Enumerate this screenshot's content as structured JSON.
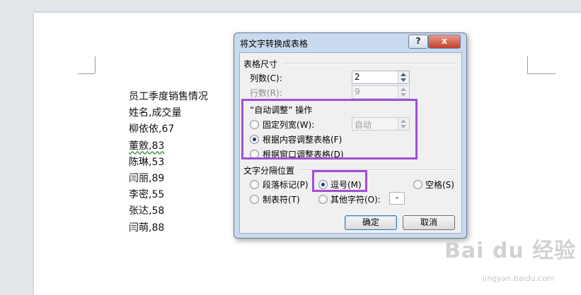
{
  "document": {
    "lines": [
      "员工季度销售情况",
      "姓名,成交量",
      "柳依依,67",
      "董敫,83",
      "陈琳,53",
      "闫丽,89",
      "李密,55",
      "张达,58",
      "闫萌,88"
    ]
  },
  "dialog": {
    "title": "将文字转换成表格",
    "help_label": "?",
    "close_label": "x",
    "table_size": {
      "section_label": "表格尺寸",
      "cols_label": "列数(C):",
      "cols_value": "2",
      "rows_label": "行数(R):",
      "rows_value": "9"
    },
    "autofit": {
      "section_label": "“自动调整” 操作",
      "fixed_label": "固定列宽(W):",
      "fixed_value": "自动",
      "content_label": "根据内容调整表格(F)",
      "window_label": "根据窗口调整表格(D)"
    },
    "separator": {
      "section_label": "文字分隔位置",
      "paragraph_label": "段落标记(P)",
      "comma_label": "逗号(M)",
      "space_label": "空格(S)",
      "tab_label": "制表符(T)",
      "other_label": "其他字符(O):",
      "other_value": "-"
    },
    "ok_label": "确定",
    "cancel_label": "取消"
  },
  "watermark": {
    "brand": "Bai du 经验",
    "url": "jingyan.baidu.com"
  },
  "colors": {
    "highlight": "#a24fd6",
    "dialog_frame": "#c9d9ee"
  }
}
